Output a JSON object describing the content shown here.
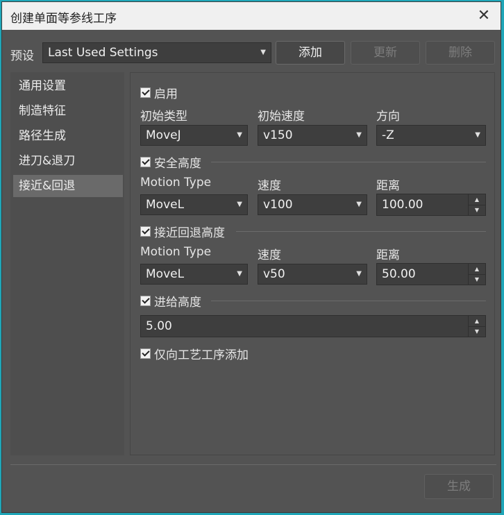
{
  "window": {
    "title": "创建单面等参线工序",
    "close_glyph": "✕"
  },
  "preset": {
    "label": "预设",
    "value": "Last Used Settings",
    "add_button": "添加",
    "update_button": "更新",
    "delete_button": "删除"
  },
  "sidebar": {
    "items": [
      {
        "label": "通用设置",
        "active": false
      },
      {
        "label": "制造特征",
        "active": false
      },
      {
        "label": "路径生成",
        "active": false
      },
      {
        "label": "进刀&退刀",
        "active": false
      },
      {
        "label": "接近&回退",
        "active": true
      }
    ]
  },
  "enable": {
    "label": "启用",
    "checked": true
  },
  "initial": {
    "type_label": "初始类型",
    "type_value": "MoveJ",
    "speed_label": "初始速度",
    "speed_value": "v150",
    "direction_label": "方向",
    "direction_value": "-Z"
  },
  "safe_height": {
    "label": "安全高度",
    "checked": true,
    "motion_label": "Motion Type",
    "motion_value": "MoveL",
    "speed_label": "速度",
    "speed_value": "v100",
    "distance_label": "距离",
    "distance_value": "100.00"
  },
  "approach_height": {
    "label": "接近回退高度",
    "checked": true,
    "motion_label": "Motion Type",
    "motion_value": "MoveL",
    "speed_label": "速度",
    "speed_value": "v50",
    "distance_label": "距离",
    "distance_value": "50.00"
  },
  "feed_height": {
    "label": "进给高度",
    "checked": true,
    "value": "5.00"
  },
  "only_add": {
    "label": "仅向工艺工序添加",
    "checked": true
  },
  "footer": {
    "generate_button": "生成"
  },
  "icons": {
    "dropdown": "▼",
    "spin_up": "▲",
    "spin_down": "▼"
  }
}
